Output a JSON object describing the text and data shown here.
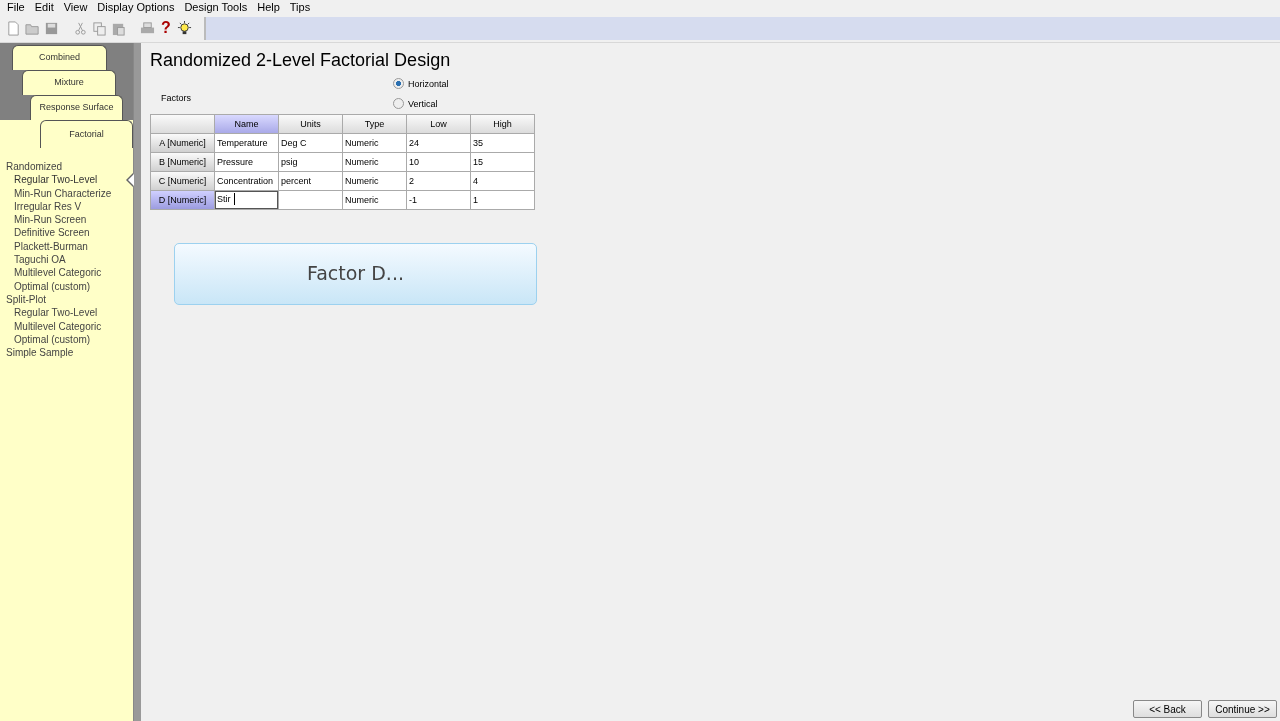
{
  "menu": [
    "File",
    "Edit",
    "View",
    "Display Options",
    "Design Tools",
    "Help",
    "Tips"
  ],
  "toolbar": [
    {
      "kind": "new"
    },
    {
      "kind": "open"
    },
    {
      "kind": "save"
    },
    {
      "kind": "sep"
    },
    {
      "kind": "cut"
    },
    {
      "kind": "copy"
    },
    {
      "kind": "paste"
    },
    {
      "kind": "sep"
    },
    {
      "kind": "print"
    },
    {
      "kind": "help",
      "text": "?"
    },
    {
      "kind": "tip"
    }
  ],
  "sidebar": {
    "tabs": [
      {
        "label": "Combined",
        "selected": false
      },
      {
        "label": "Mixture",
        "selected": false
      },
      {
        "label": "Response Surface",
        "selected": false
      },
      {
        "label": "Factorial",
        "selected": true
      }
    ],
    "tree": [
      {
        "label": "Randomized",
        "selected": false,
        "children": [
          {
            "label": "Regular Two-Level",
            "selected": true
          },
          {
            "label": "Min-Run Characterize",
            "selected": false
          },
          {
            "label": "Irregular Res V",
            "selected": false
          },
          {
            "label": "Min-Run Screen",
            "selected": false
          },
          {
            "label": "Definitive Screen",
            "selected": false
          },
          {
            "label": "Plackett-Burman",
            "selected": false
          },
          {
            "label": "Taguchi OA",
            "selected": false
          },
          {
            "label": "Multilevel Categoric",
            "selected": false
          },
          {
            "label": "Optimal (custom)",
            "selected": false
          }
        ]
      },
      {
        "label": "Split-Plot",
        "selected": false,
        "children": [
          {
            "label": "Regular Two-Level",
            "selected": false
          },
          {
            "label": "Multilevel Categoric",
            "selected": false
          },
          {
            "label": "Optimal (custom)",
            "selected": false
          }
        ]
      },
      {
        "label": "Simple Sample",
        "selected": false
      }
    ]
  },
  "title": "Randomized 2-Level Factorial Design",
  "factors_label": "Factors",
  "orientation": [
    {
      "label": "Horizontal",
      "selected": true
    },
    {
      "label": "Vertical",
      "selected": false
    }
  ],
  "table": {
    "columns": [
      {
        "label": "Name",
        "selected": true
      },
      {
        "label": "Units",
        "selected": false
      },
      {
        "label": "Type",
        "selected": false
      },
      {
        "label": "Low",
        "selected": false
      },
      {
        "label": "High",
        "selected": false
      }
    ],
    "rows": [
      {
        "label": "A [Numeric]",
        "selected": false,
        "editing": false,
        "cells": [
          "Temperature",
          "Deg C",
          "Numeric",
          "24",
          "35"
        ]
      },
      {
        "label": "B [Numeric]",
        "selected": false,
        "editing": false,
        "cells": [
          "Pressure",
          "psig",
          "Numeric",
          "10",
          "15"
        ]
      },
      {
        "label": "C [Numeric]",
        "selected": false,
        "editing": false,
        "cells": [
          "Concentration",
          "percent",
          "Numeric",
          "2",
          "4"
        ]
      },
      {
        "label": "D [Numeric]",
        "selected": true,
        "editing": true,
        "cells": [
          "Stir",
          "",
          "Numeric",
          "-1",
          "1"
        ]
      }
    ]
  },
  "hint": "Factor D...",
  "buttons": [
    "<< Back",
    "Continue >>"
  ]
}
